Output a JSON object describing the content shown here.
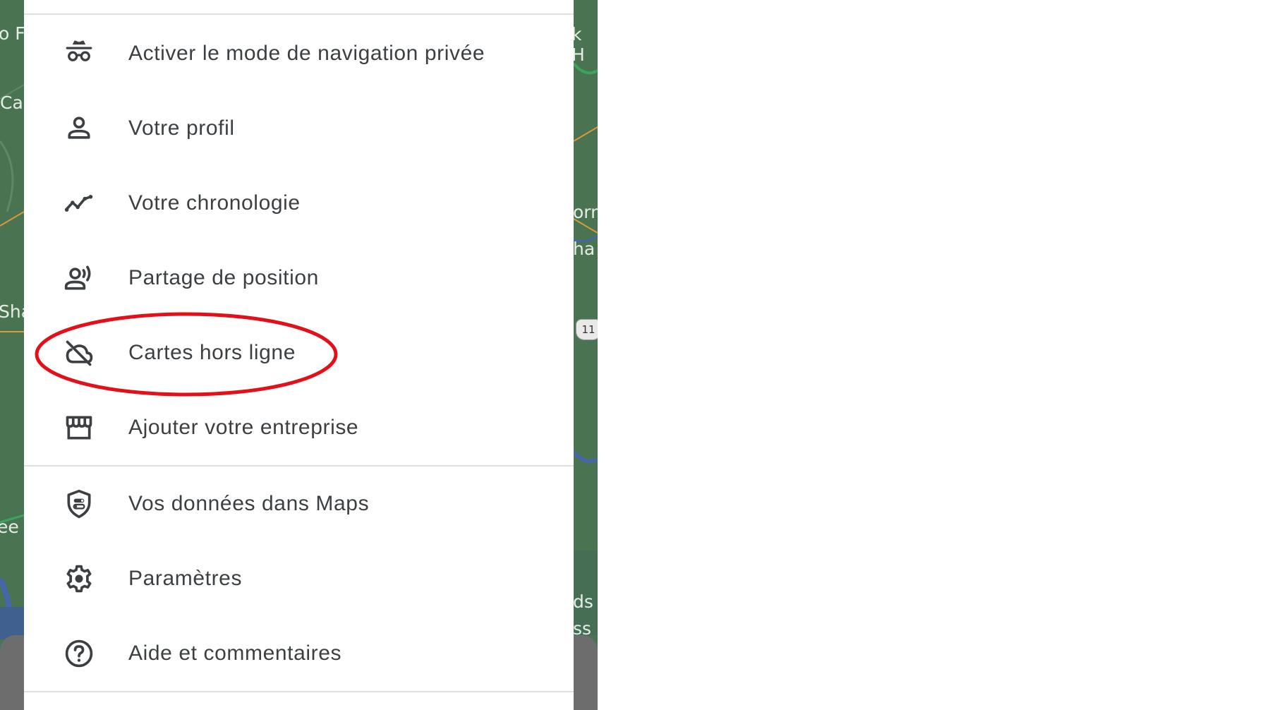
{
  "colors": {
    "map_green": "#47704f",
    "drawer_bg": "#ffffff",
    "text": "#3c4043",
    "icon": "#3c4043",
    "divider": "#e0e0e0",
    "highlight": "#e3101a"
  },
  "map": {
    "labels_left": [
      "o F",
      "Ca",
      "Sha",
      "ee"
    ],
    "labels_right": [
      "k H",
      "orn",
      "ha",
      "ds",
      "ss"
    ],
    "shield_right": "11"
  },
  "menu": {
    "items": [
      {
        "label": "Activer le mode de navigation privée",
        "icon": "incognito-icon"
      },
      {
        "label": "Votre profil",
        "icon": "person-icon"
      },
      {
        "label": "Votre chronologie",
        "icon": "timeline-icon"
      },
      {
        "label": "Partage de position",
        "icon": "location-sharing-icon"
      },
      {
        "label": "Cartes hors ligne",
        "icon": "cloud-off-icon"
      },
      {
        "label": "Ajouter votre entreprise",
        "icon": "storefront-icon"
      },
      {
        "label": "Vos données dans Maps",
        "icon": "shield-data-icon"
      },
      {
        "label": "Paramètres",
        "icon": "gear-icon"
      },
      {
        "label": "Aide et commentaires",
        "icon": "help-icon"
      }
    ]
  },
  "annotation": {
    "highlighted_item": "Cartes hors ligne",
    "shape": "ellipse"
  }
}
